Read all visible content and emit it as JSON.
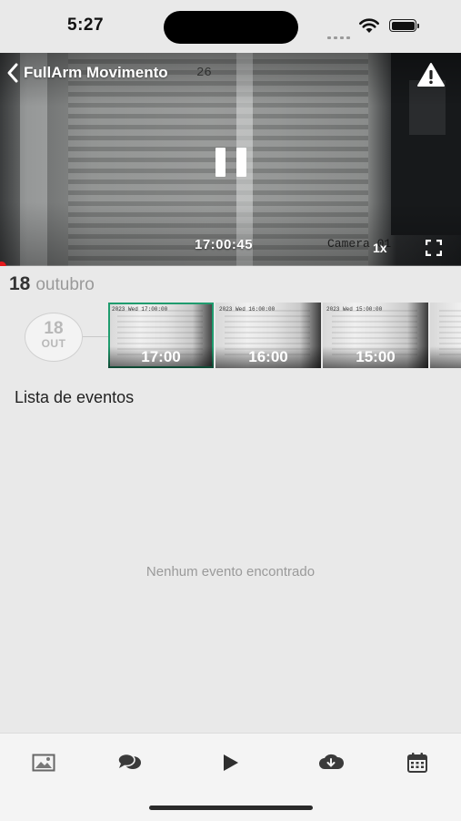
{
  "status_bar": {
    "time": "5:27"
  },
  "camera": {
    "title": "FullArm Movimento",
    "overlay_number": "26",
    "current_time": "17:00:45",
    "camera_label": "Camera 01",
    "speed": "1x"
  },
  "date": {
    "day": "18",
    "month": "outubro"
  },
  "day_selector": {
    "day": "18",
    "month_abbr": "OUT"
  },
  "timeline": {
    "thumbnails": [
      {
        "time": "17:00",
        "selected": true
      },
      {
        "time": "16:00",
        "selected": false
      },
      {
        "time": "15:00",
        "selected": false
      },
      {
        "time": "",
        "selected": false
      }
    ]
  },
  "events": {
    "title": "Lista de eventos",
    "empty_message": "Nenhum evento encontrado"
  },
  "tab_bar": {
    "items": [
      "image-icon",
      "chat-icon",
      "play-icon",
      "cloud-download-icon",
      "calendar-icon"
    ]
  },
  "colors": {
    "accent": "#1f9c6e",
    "progress": "#e5191c",
    "background": "#e9e9e9"
  }
}
